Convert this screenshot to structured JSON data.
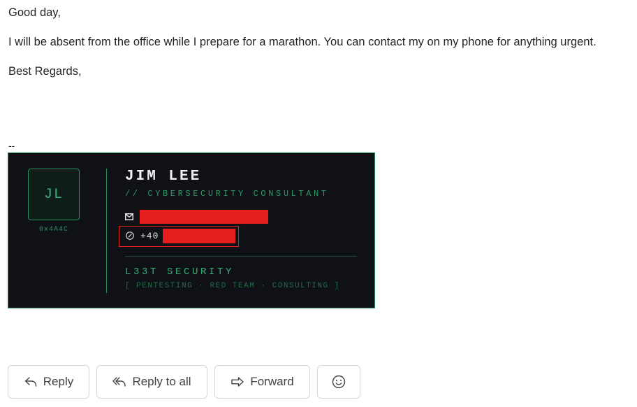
{
  "message": {
    "greeting": "Good day,",
    "body": "I will be absent from the office while I prepare for a marathon. You can contact my on my phone for anything urgent.",
    "closing": "Best Regards,",
    "separator": "--"
  },
  "signature": {
    "initials": "JL",
    "hex_code": "0x4A4C",
    "name": "JIM LEE",
    "role": "// CYBERSECURITY CONSULTANT",
    "phone_prefix": "+40",
    "company": "L33T SECURITY",
    "services": "[ PENTESTING · RED TEAM · CONSULTING ]",
    "colors": {
      "background": "#0f1116",
      "accent": "#35b075",
      "redaction": "#e41e1e"
    },
    "icons": {
      "email": "mail-icon",
      "phone": "phone-icon"
    }
  },
  "actions": {
    "reply": "Reply",
    "reply_all": "Reply to all",
    "forward": "Forward",
    "emoji_icon": "smiley-icon"
  }
}
